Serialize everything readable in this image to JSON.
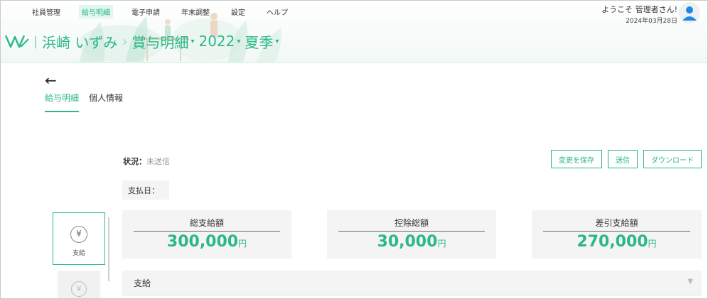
{
  "nav": {
    "items": [
      {
        "label": "社員管理",
        "active": false
      },
      {
        "label": "給与明細",
        "active": true
      },
      {
        "label": "電子申請",
        "active": false
      },
      {
        "label": "年末調整",
        "active": false
      },
      {
        "label": "設定",
        "active": false
      },
      {
        "label": "ヘルプ",
        "active": false
      }
    ]
  },
  "user": {
    "welcome": "ようこそ 管理者さん!",
    "date": "2024年03月28日",
    "avatar_icon": "user-avatar-icon"
  },
  "breadcrumb": {
    "employee": "浜崎 いずみ",
    "type": "賞与明細",
    "year": "2022",
    "season": "夏季",
    "caret": "▾",
    "separator": "|",
    "arrow": "›"
  },
  "back": {
    "icon": "arrow-left-icon",
    "glyph": "←"
  },
  "tabs": [
    {
      "label": "給与明細",
      "active": true
    },
    {
      "label": "個人情報",
      "active": false
    }
  ],
  "status": {
    "label": "状況：",
    "value": "未送信"
  },
  "actions": {
    "save": "変更を保存",
    "send": "送信",
    "download": "ダウンロード"
  },
  "payday": {
    "label": "支払日："
  },
  "side_tabs": [
    {
      "label": "支給",
      "icon": "yen-icon",
      "glyph": "¥",
      "active": true
    },
    {
      "label": "",
      "icon": "yen-icon",
      "glyph": "¥",
      "active": false
    }
  ],
  "summary": [
    {
      "title": "総支給額",
      "value": "300,000",
      "unit": "円"
    },
    {
      "title": "控除総額",
      "value": "30,000",
      "unit": "円"
    },
    {
      "title": "差引支給額",
      "value": "270,000",
      "unit": "円"
    }
  ],
  "section": {
    "title": "支給",
    "caret": "▼"
  },
  "colors": {
    "accent": "#2ab886",
    "accent_light": "#e2f6ef",
    "panel": "#f4f4f4"
  }
}
